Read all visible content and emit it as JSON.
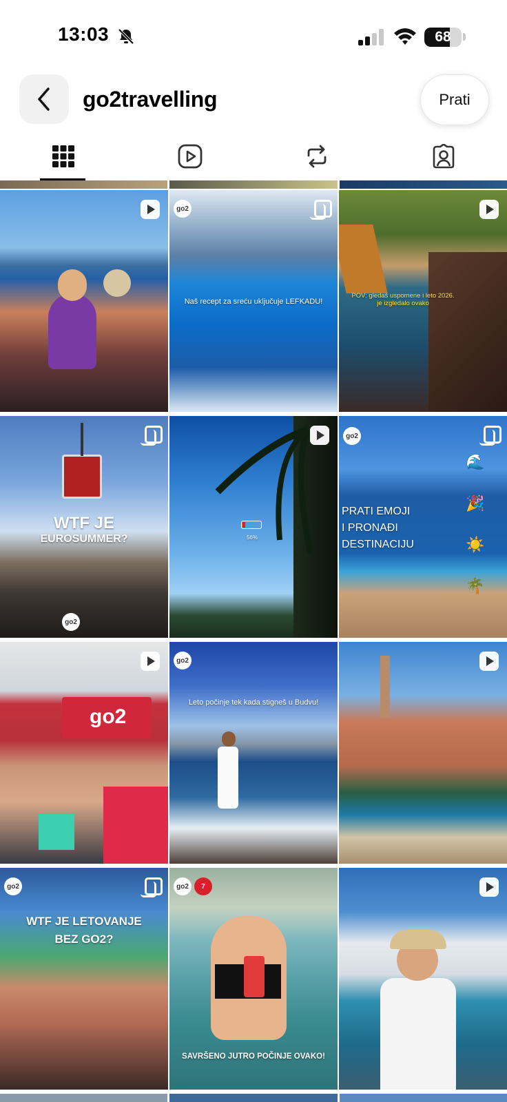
{
  "status_bar": {
    "time": "13:03",
    "battery": "68",
    "battery_level": 0.68
  },
  "header": {
    "username": "go2travelling",
    "follow_label": "Prati"
  },
  "tabs": [
    "grid",
    "reels",
    "reposts",
    "tagged"
  ],
  "posts": [
    {
      "badge": "reel",
      "caption": ""
    },
    {
      "badge": "multi",
      "logo": "go2",
      "caption": "Naš recept za sreću uključuje LEFKADU!"
    },
    {
      "badge": "reel",
      "caption": "POV: gledaš uspomene i leto 2026. je izgledalo ovako"
    },
    {
      "badge": "multi",
      "logo": "go2",
      "caption_line1": "WTF JE",
      "caption_line2": "EUROSUMMER?"
    },
    {
      "badge": "reel",
      "battery_text": "56%"
    },
    {
      "badge": "multi",
      "logo": "go2",
      "caption_line1": "PRATI EMOJI",
      "caption_line2": "I PRONAĐI",
      "caption_line3": "DESTINACIJU",
      "emojis": [
        "🌊",
        "🎉",
        "☀️",
        "🌴"
      ]
    },
    {
      "badge": "reel",
      "caption": "",
      "banner_text": "go2"
    },
    {
      "badge": "none",
      "logo": "go2",
      "caption": "Leto počinje tek kada stigneš u Budvu!"
    },
    {
      "badge": "reel",
      "caption": ""
    },
    {
      "badge": "multi",
      "logo": "go2",
      "caption_line1": "WTF JE LETOVANJE",
      "caption_line2": "BEZ GO2?"
    },
    {
      "badge": "none",
      "logo": "go2",
      "logo2": "7",
      "caption": "SAVRŠENO JUTRO POČINJE OVAKO!"
    },
    {
      "badge": "reel",
      "caption": ""
    }
  ]
}
